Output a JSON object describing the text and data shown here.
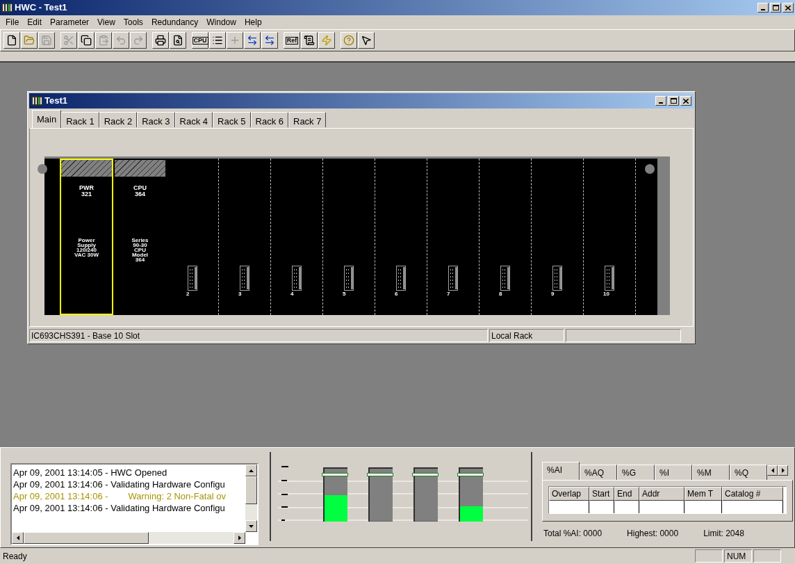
{
  "window": {
    "title": "HWC - Test1"
  },
  "menu": [
    "File",
    "Edit",
    "Parameter",
    "View",
    "Tools",
    "Redundancy",
    "Window",
    "Help"
  ],
  "toolbar": [
    [
      {
        "kind": "new",
        "disabled": false
      },
      {
        "kind": "open",
        "disabled": false
      },
      {
        "kind": "save",
        "disabled": true
      }
    ],
    [
      {
        "kind": "cut",
        "disabled": true
      },
      {
        "kind": "copy",
        "disabled": false
      },
      {
        "kind": "paste",
        "disabled": true
      },
      {
        "kind": "undo",
        "disabled": true
      },
      {
        "kind": "redo",
        "disabled": true
      }
    ],
    [
      {
        "kind": "print",
        "disabled": false
      },
      {
        "kind": "preview",
        "disabled": false
      }
    ],
    [
      {
        "kind": "cpu",
        "disabled": false,
        "label": "CPU"
      },
      {
        "kind": "list",
        "disabled": false
      },
      {
        "kind": "add",
        "disabled": true
      },
      {
        "kind": "swap",
        "disabled": false
      },
      {
        "kind": "swap",
        "disabled": false
      }
    ],
    [
      {
        "kind": "ref",
        "disabled": false,
        "label": "Ref"
      },
      {
        "kind": "scroll",
        "disabled": false
      },
      {
        "kind": "power",
        "disabled": false
      }
    ],
    [
      {
        "kind": "help",
        "disabled": false
      },
      {
        "kind": "context-help",
        "disabled": false
      }
    ]
  ],
  "child_window": {
    "title": "Test1",
    "tabs": [
      {
        "label": "Main",
        "selected": true
      },
      {
        "label": "Rack 1",
        "selected": false
      },
      {
        "label": "Rack 2",
        "selected": false
      },
      {
        "label": "Rack 3",
        "selected": false
      },
      {
        "label": "Rack 4",
        "selected": false
      },
      {
        "label": "Rack 5",
        "selected": false
      },
      {
        "label": "Rack 6",
        "selected": false
      },
      {
        "label": "Rack 7",
        "selected": false
      }
    ],
    "rack": {
      "modules": [
        {
          "kind": "module",
          "name": "PWR\n321",
          "description": "Power\nSupply\n120/240\nVAC 30W",
          "selected": true
        },
        {
          "kind": "module",
          "name": "CPU\n364",
          "description": "Series\n90-30\nCPU\nModel\n364",
          "selected": false
        },
        {
          "kind": "empty",
          "slot": "2",
          "selected": false
        },
        {
          "kind": "empty",
          "slot": "3",
          "selected": false
        },
        {
          "kind": "empty",
          "slot": "4",
          "selected": false
        },
        {
          "kind": "empty",
          "slot": "5",
          "selected": false
        },
        {
          "kind": "empty",
          "slot": "6",
          "selected": false
        },
        {
          "kind": "empty",
          "slot": "7",
          "selected": false
        },
        {
          "kind": "empty",
          "slot": "8",
          "selected": false
        },
        {
          "kind": "empty",
          "slot": "9",
          "selected": false
        },
        {
          "kind": "empty",
          "slot": "10",
          "selected": false
        }
      ]
    },
    "status_bar": [
      "IC693CHS391 - Base 10 Slot",
      "Local Rack"
    ]
  },
  "log": [
    {
      "kind": "info",
      "text": "Apr 09, 2001 13:14:05 - HWC Opened"
    },
    {
      "kind": "info",
      "text": "Apr 09, 2001 13:14:06 - Validating Hardware Configu"
    },
    {
      "kind": "warning",
      "text": "Apr 09, 2001 13:14:06 -        Warning: 2 Non-Fatal ov"
    },
    {
      "kind": "info",
      "text": "Apr 09, 2001 13:14:06 - Validating Hardware Configu"
    }
  ],
  "power_meters": [
    {
      "level": 0.5
    },
    {
      "level": 0
    },
    {
      "level": 0
    },
    {
      "level": 0.29
    }
  ],
  "memory": {
    "tabs": [
      {
        "label": "%AI",
        "selected": true
      },
      {
        "label": "%AQ",
        "selected": false
      },
      {
        "label": "%G",
        "selected": false
      },
      {
        "label": "%I",
        "selected": false
      },
      {
        "label": "%M",
        "selected": false
      },
      {
        "label": "%Q",
        "selected": false
      }
    ],
    "columns": [
      "Overlap",
      "Start",
      "End",
      "Addr",
      "Mem T",
      "Catalog #"
    ],
    "summary": [
      "Total %AI: 0000",
      "Highest: 0000",
      "Limit: 2048"
    ]
  },
  "status_bar": {
    "message": "Ready",
    "indicator": "NUM"
  }
}
